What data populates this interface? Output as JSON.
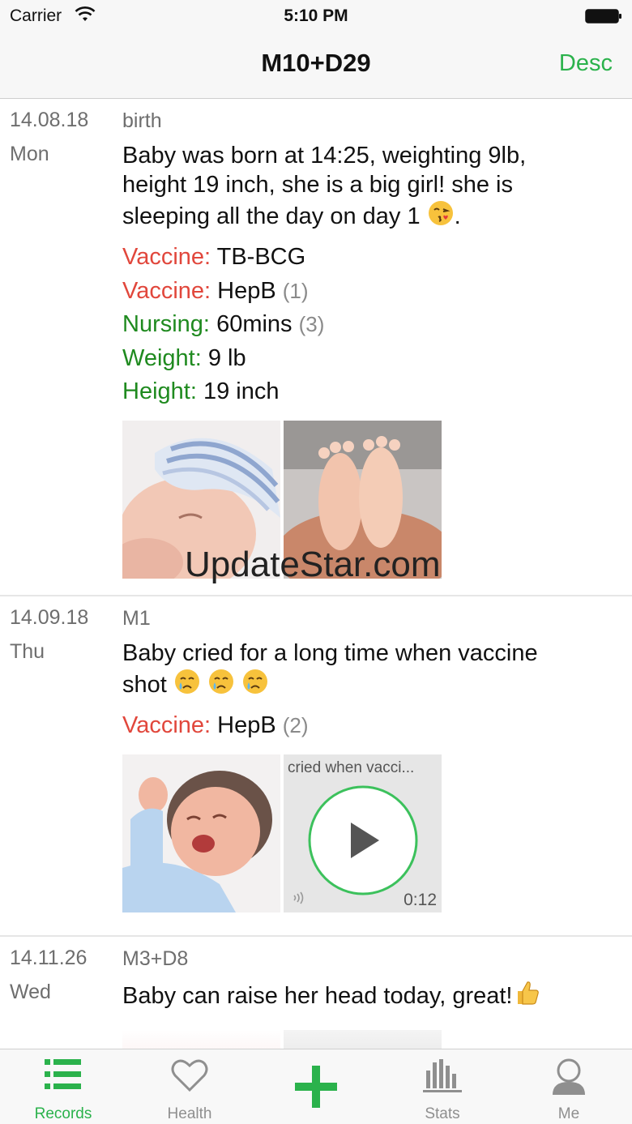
{
  "status": {
    "carrier": "Carrier",
    "time": "5:10 PM"
  },
  "nav": {
    "title": "M10+D29",
    "sort_label": "Desc"
  },
  "entries": [
    {
      "date": "14.08.18",
      "day": "Mon",
      "tag": "birth",
      "text": "Baby was born at 14:25, weighting 9lb, height 19 inch, she is a big girl! she is sleeping all the day on day 1",
      "text_suffix": ".",
      "meta": [
        {
          "key": "Vaccine:",
          "value": "TB-BCG",
          "count": ""
        },
        {
          "key": "Vaccine:",
          "value": "HepB",
          "count": "(1)"
        },
        {
          "key": "Nursing:",
          "value": "60mins",
          "count": "(3)"
        },
        {
          "key": "Weight:",
          "value": "9 lb",
          "count": ""
        },
        {
          "key": "Height:",
          "value": "19 inch",
          "count": ""
        }
      ]
    },
    {
      "date": "14.09.18",
      "day": "Thu",
      "tag": "M1",
      "text": "Baby cried for a long time when vaccine shot",
      "meta": [
        {
          "key": "Vaccine:",
          "value": "HepB",
          "count": "(2)"
        }
      ],
      "voice_note": {
        "title": "cried when vacci...",
        "duration": "0:12"
      }
    },
    {
      "date": "14.11.26",
      "day": "Wed",
      "tag": "M3+D8",
      "text": "Baby can raise her head today, great!"
    }
  ],
  "watermark": "UpdateStar.com",
  "tabs": [
    {
      "label": "Records",
      "icon": "list-icon"
    },
    {
      "label": "Health",
      "icon": "heart-icon"
    },
    {
      "label": "",
      "icon": "add-icon"
    },
    {
      "label": "Stats",
      "icon": "stats-icon"
    },
    {
      "label": "Me",
      "icon": "profile-icon"
    }
  ],
  "colors": {
    "accent": "#2bb24c",
    "vaccine": "#e1473c",
    "measure": "#1f8a1f",
    "secondary_text": "#6e6e6e"
  }
}
